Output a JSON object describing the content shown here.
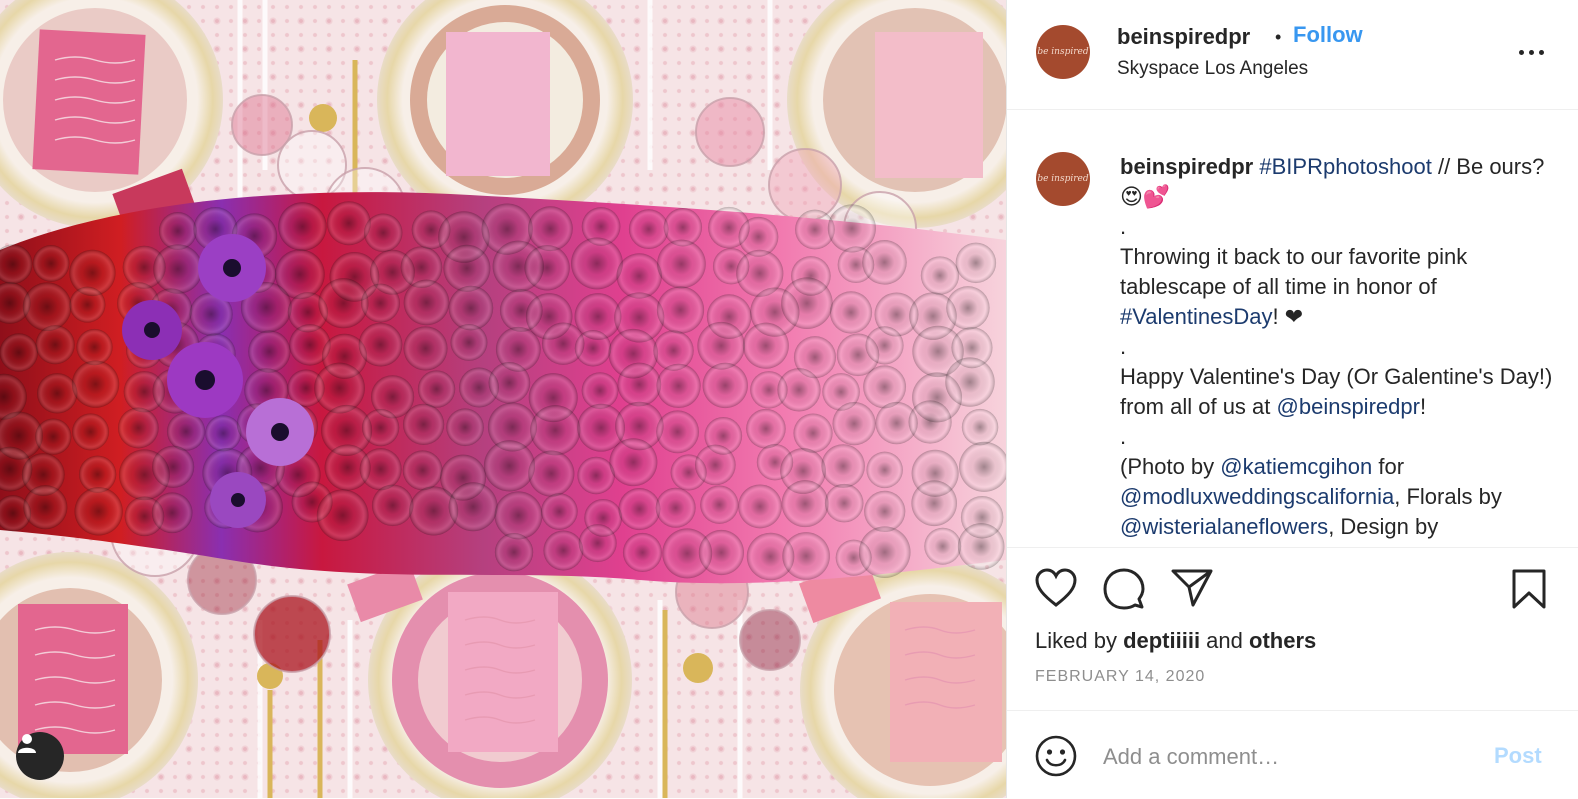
{
  "post": {
    "username": "beinspiredpr",
    "separator": "•",
    "follow_label": "Follow",
    "location": "Skyspace Los Angeles",
    "logo_text": "be inspired"
  },
  "caption": {
    "username": "beinspiredpr",
    "line1_tag": "#BIPRphotoshoot",
    "line1_text": " // Be ours? 😍💕",
    "dot1": ".",
    "para1": "Throwing it back to our favorite pink tablescape of all time in honor of ",
    "para1_tag": "#ValentinesDay",
    "para1_end": "! ❤",
    "dot2": ".",
    "para2": "Happy Valentine's Day (Or Galentine's Day!) from all of us at ",
    "para2_tag": "@beinspiredpr",
    "para2_end": "!",
    "dot3": ".",
    "para3_a": "(Photo by ",
    "para3_tag1": "@katiemcgihon",
    "para3_b": " for ",
    "para3_tag2": "@modluxweddingscalifornia",
    "para3_c": ", Florals by ",
    "para3_tag3": "@wisterialaneflowers",
    "para3_d": ", Design by"
  },
  "actions": {
    "liked_prefix": "Liked by ",
    "liked_user": "deptiiiii",
    "liked_mid": " and ",
    "liked_others": "others",
    "date": "FEBRUARY 14, 2020"
  },
  "comment": {
    "placeholder": "Add a comment…",
    "post_label": "Post"
  },
  "icons": {
    "like": "heart-icon",
    "comment": "comment-icon",
    "share": "paper-plane-icon",
    "save": "bookmark-icon",
    "emoji": "smiley-icon",
    "more": "more-options-icon",
    "account": "user-icon"
  },
  "colors": {
    "follow": "#3897f0",
    "tag": "#1c3b6e",
    "meta": "#8e8e8e",
    "post_disabled": "#b3dbff",
    "logo": "#a44a2e"
  }
}
